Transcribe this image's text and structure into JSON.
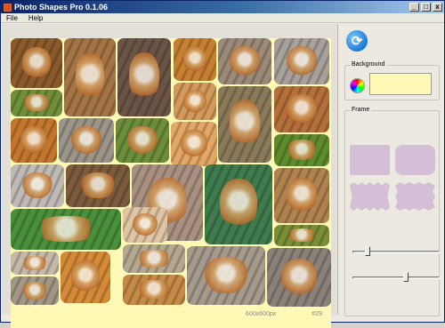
{
  "window": {
    "title": "Photo Shapes Pro 0.1.06",
    "minimize_label": "_",
    "maximize_label": "□",
    "close_label": "x"
  },
  "menu": {
    "items": [
      "File",
      "Help"
    ]
  },
  "status": {
    "size": "600x600px",
    "count": "#29"
  },
  "sidebar": {
    "refresh_icon": "refresh-icon",
    "background_label": "Background",
    "background_color": "#fff9b5",
    "frame_label": "Frame",
    "frame_color": "#d5bfd7",
    "slider1_value": 0.15,
    "slider2_value": 0.62
  },
  "board": {
    "background": "#fff9b5"
  }
}
